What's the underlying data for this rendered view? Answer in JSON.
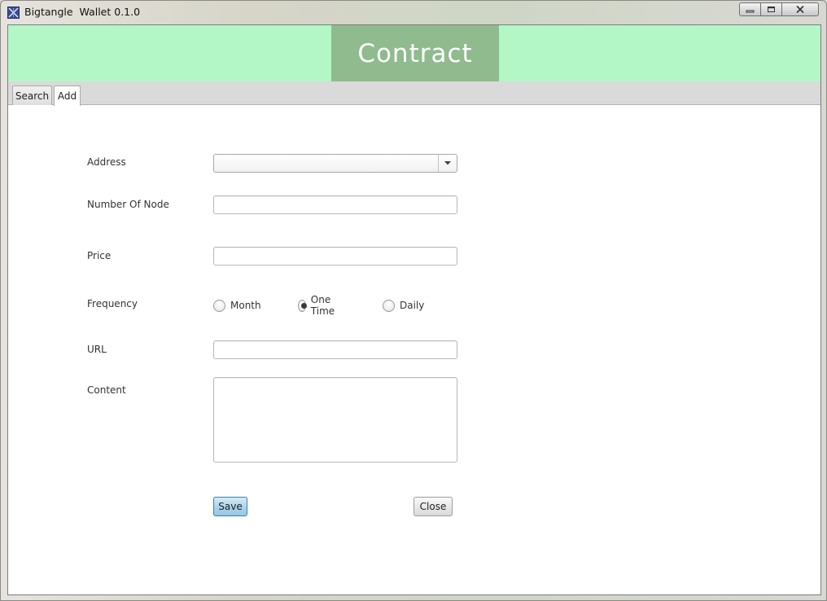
{
  "window": {
    "title": "Bigtangle  Wallet 0.1.0",
    "controls": [
      "minimize-icon",
      "maximize-icon",
      "close-icon"
    ]
  },
  "banner": {
    "title": "Contract",
    "background_color": "#b3f7c6",
    "title_box_color": "#8fbb8e"
  },
  "tabs": [
    {
      "label": "Search",
      "selected": false
    },
    {
      "label": "Add",
      "selected": true
    }
  ],
  "form": {
    "address": {
      "label": "Address",
      "value": ""
    },
    "number_of_node": {
      "label": "Number Of Node",
      "value": ""
    },
    "price": {
      "label": "Price",
      "value": ""
    },
    "frequency": {
      "label": "Frequency",
      "options": [
        "Month",
        "One Time",
        "Daily"
      ],
      "selected": "One Time"
    },
    "url": {
      "label": "URL",
      "value": ""
    },
    "content": {
      "label": "Content",
      "value": ""
    }
  },
  "buttons": {
    "save_label": "Save",
    "close_label": "Close",
    "save_color": "#a9d3ea"
  }
}
